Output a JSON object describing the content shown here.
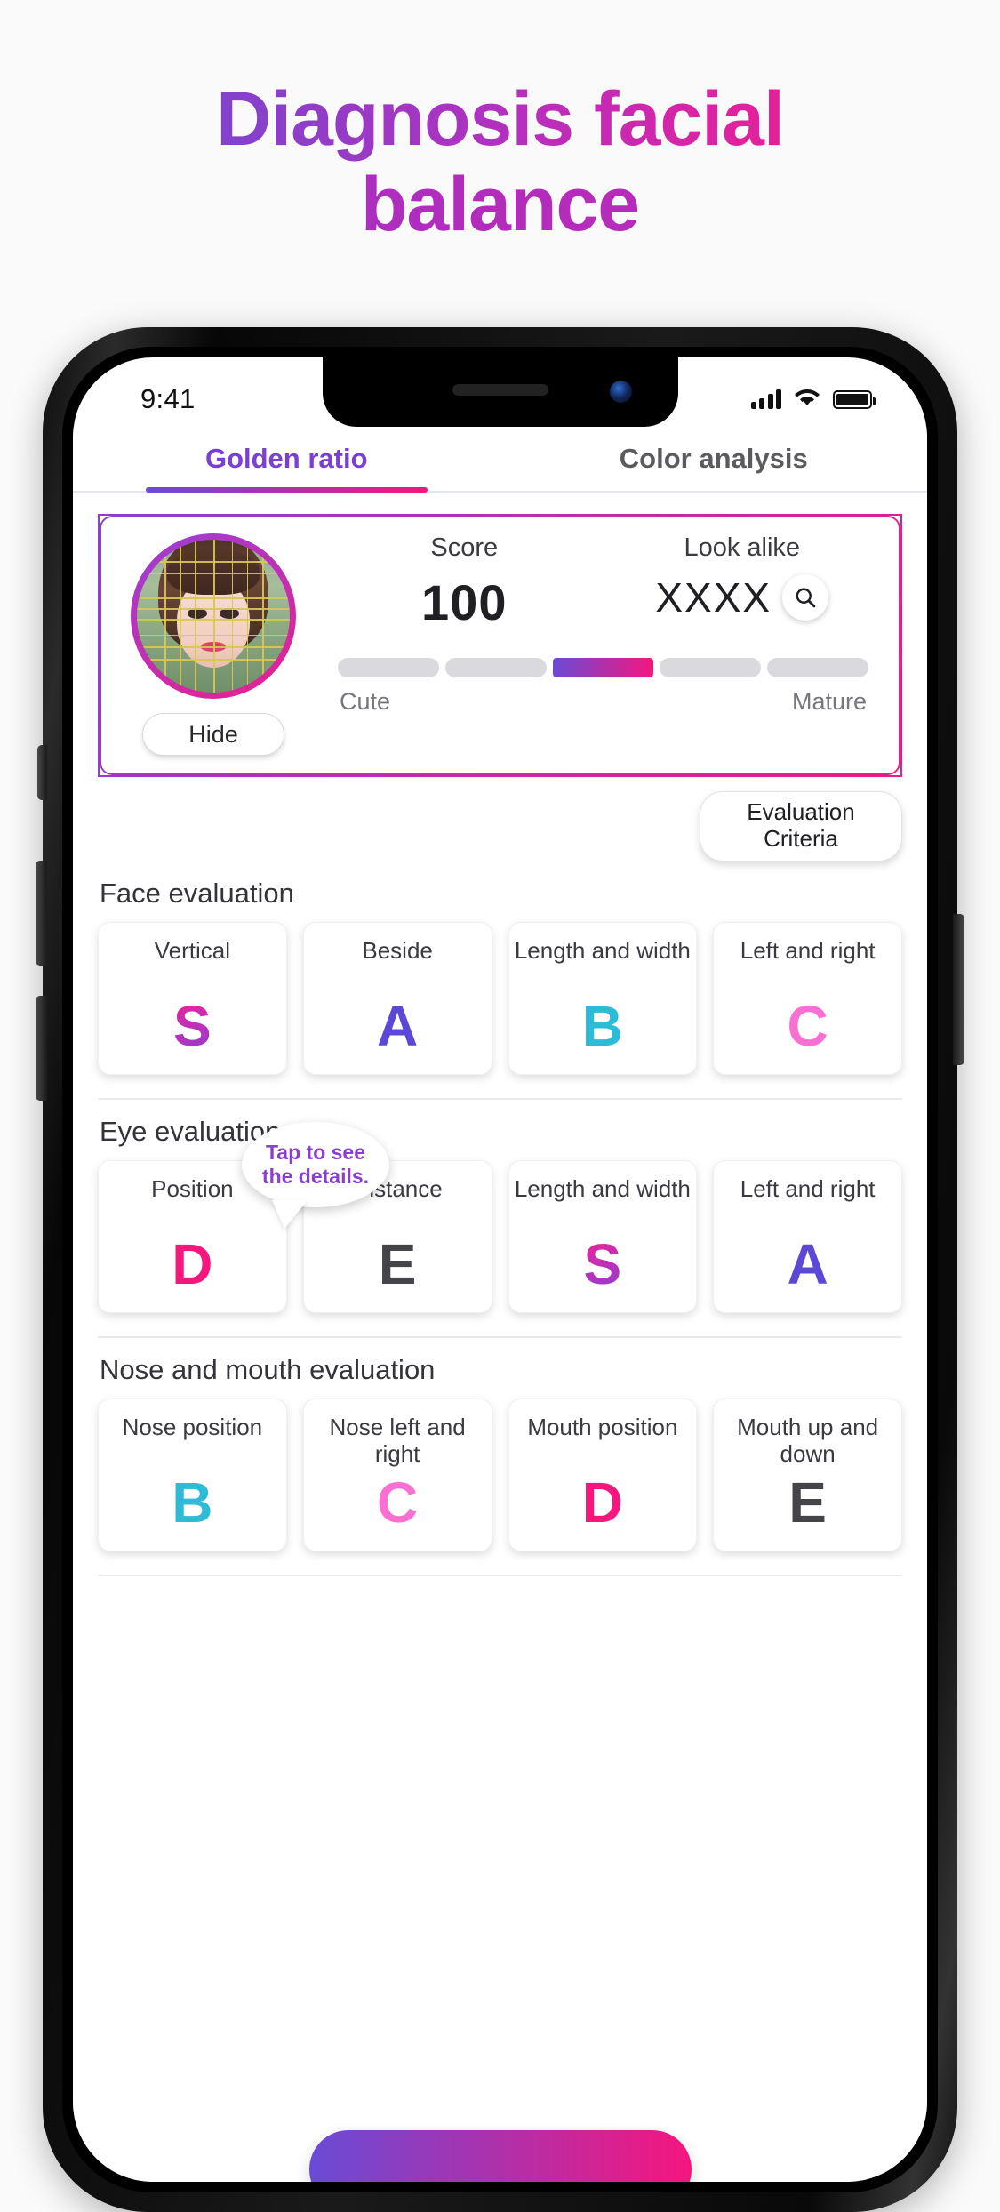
{
  "headline": {
    "line1": "Diagnosis facial",
    "line2": "balance",
    "gradient_start": "#6A4BD6",
    "gradient_end": "#F5167E"
  },
  "status_bar": {
    "time": "9:41",
    "signal_icon": "cellular-signal-icon",
    "wifi_icon": "wifi-icon",
    "battery_icon": "battery-full-icon"
  },
  "tabs": [
    {
      "label": "Golden ratio",
      "active": true
    },
    {
      "label": "Color analysis",
      "active": false
    }
  ],
  "score_card": {
    "hide_button": "Hide",
    "score_label": "Score",
    "score_value": "100",
    "look_alike_label": "Look alike",
    "look_alike_value": "XXXX",
    "search_icon": "search-icon",
    "slider": {
      "segments": 5,
      "active_index": 2,
      "left_label": "Cute",
      "right_label": "Mature"
    }
  },
  "criteria_button": {
    "line1": "Evaluation",
    "line2": "Criteria"
  },
  "tooltip": {
    "line1": "Tap to see",
    "line2": "the details."
  },
  "sections": [
    {
      "title": "Face evaluation",
      "cards": [
        {
          "label": "Vertical",
          "grade": "S",
          "color": "#C52FB4"
        },
        {
          "label": "Beside",
          "grade": "A",
          "color": "#5B48D6"
        },
        {
          "label": "Length and width",
          "grade": "B",
          "color": "#2EBBD8"
        },
        {
          "label": "Left and right",
          "grade": "C",
          "color": "#FA6FD2"
        }
      ]
    },
    {
      "title": "Eye evaluation",
      "cards": [
        {
          "label": "Position",
          "grade": "D",
          "color": "#F5167E"
        },
        {
          "label": "Distance",
          "grade": "E",
          "color": "#444449"
        },
        {
          "label": "Length and width",
          "grade": "S",
          "color": "#C52FB4"
        },
        {
          "label": "Left and right",
          "grade": "A",
          "color": "#5B48D6"
        }
      ]
    },
    {
      "title": "Nose and mouth evaluation",
      "cards": [
        {
          "label": "Nose position",
          "grade": "B",
          "color": "#2EBBD8"
        },
        {
          "label": "Nose left and right",
          "grade": "C",
          "color": "#FA6FD2"
        },
        {
          "label": "Mouth position",
          "grade": "D",
          "color": "#F5167E"
        },
        {
          "label": "Mouth up and down",
          "grade": "E",
          "color": "#444449"
        }
      ]
    }
  ]
}
